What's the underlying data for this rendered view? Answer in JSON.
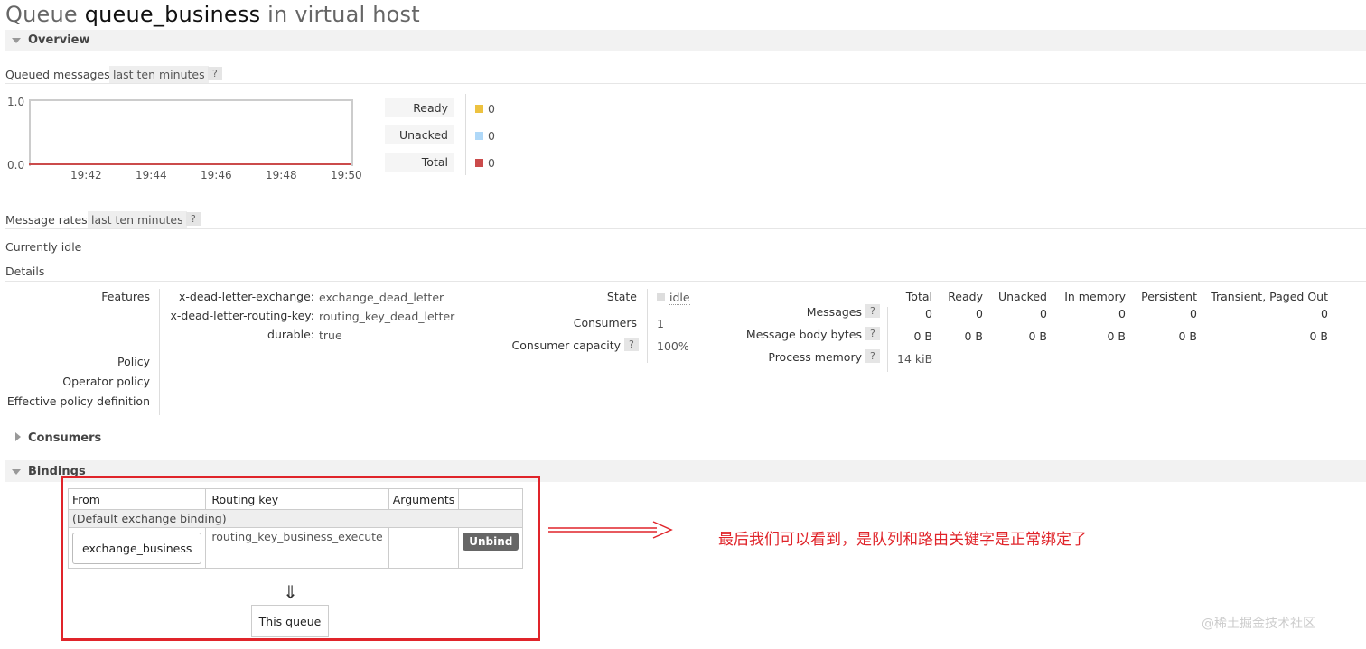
{
  "title": {
    "prefix": "Queue",
    "queue_name": "queue_business",
    "suffix": "in virtual host"
  },
  "sections": {
    "overview": "Overview",
    "consumers": "Consumers",
    "bindings": "Bindings"
  },
  "queued_messages": {
    "label": "Queued messages",
    "range": "last ten minutes",
    "help": "?",
    "y_ticks": [
      "1.0",
      "0.0"
    ],
    "x_ticks": [
      "19:42",
      "19:44",
      "19:46",
      "19:48",
      "19:50"
    ],
    "legend": [
      {
        "label": "Ready",
        "value": "0",
        "color": "#edc240"
      },
      {
        "label": "Unacked",
        "value": "0",
        "color": "#afd8f8"
      },
      {
        "label": "Total",
        "value": "0",
        "color": "#cb4b4b"
      }
    ]
  },
  "message_rates": {
    "label": "Message rates",
    "range": "last ten minutes",
    "help": "?",
    "status": "Currently idle"
  },
  "details": {
    "label": "Details",
    "features_label": "Features",
    "features": [
      {
        "key": "x-dead-letter-exchange:",
        "value": "exchange_dead_letter"
      },
      {
        "key": "x-dead-letter-routing-key:",
        "value": "routing_key_dead_letter"
      },
      {
        "key": "durable:",
        "value": "true"
      }
    ],
    "policy_label": "Policy",
    "operator_policy_label": "Operator policy",
    "effective_policy_label": "Effective policy definition",
    "state_label": "State",
    "state_value": "idle",
    "consumers_label": "Consumers",
    "consumers_value": "1",
    "consumer_capacity_label": "Consumer capacity",
    "consumer_capacity_value": "100%",
    "help": "?",
    "stats_columns": [
      "Total",
      "Ready",
      "Unacked",
      "In memory",
      "Persistent",
      "Transient, Paged Out"
    ],
    "stats_rows": [
      {
        "label": "Messages",
        "values": [
          "0",
          "0",
          "0",
          "0",
          "0",
          "0"
        ]
      },
      {
        "label": "Message body bytes",
        "values": [
          "0 B",
          "0 B",
          "0 B",
          "0 B",
          "0 B",
          "0 B"
        ]
      },
      {
        "label": "Process memory",
        "values": [
          "14 kiB"
        ]
      }
    ]
  },
  "bindings": {
    "columns": [
      "From",
      "Routing key",
      "Arguments"
    ],
    "default_binding": "(Default exchange binding)",
    "row": {
      "from": "exchange_business",
      "routing_key": "routing_key_business_execute",
      "arguments": "",
      "action": "Unbind"
    },
    "down_arrow": "⇓",
    "this_queue": "This queue"
  },
  "annotation": {
    "text": "最后我们可以看到，是队列和路由关键字是正常绑定了",
    "color": "#e0242a"
  },
  "watermark": "@稀土掘金技术社区"
}
